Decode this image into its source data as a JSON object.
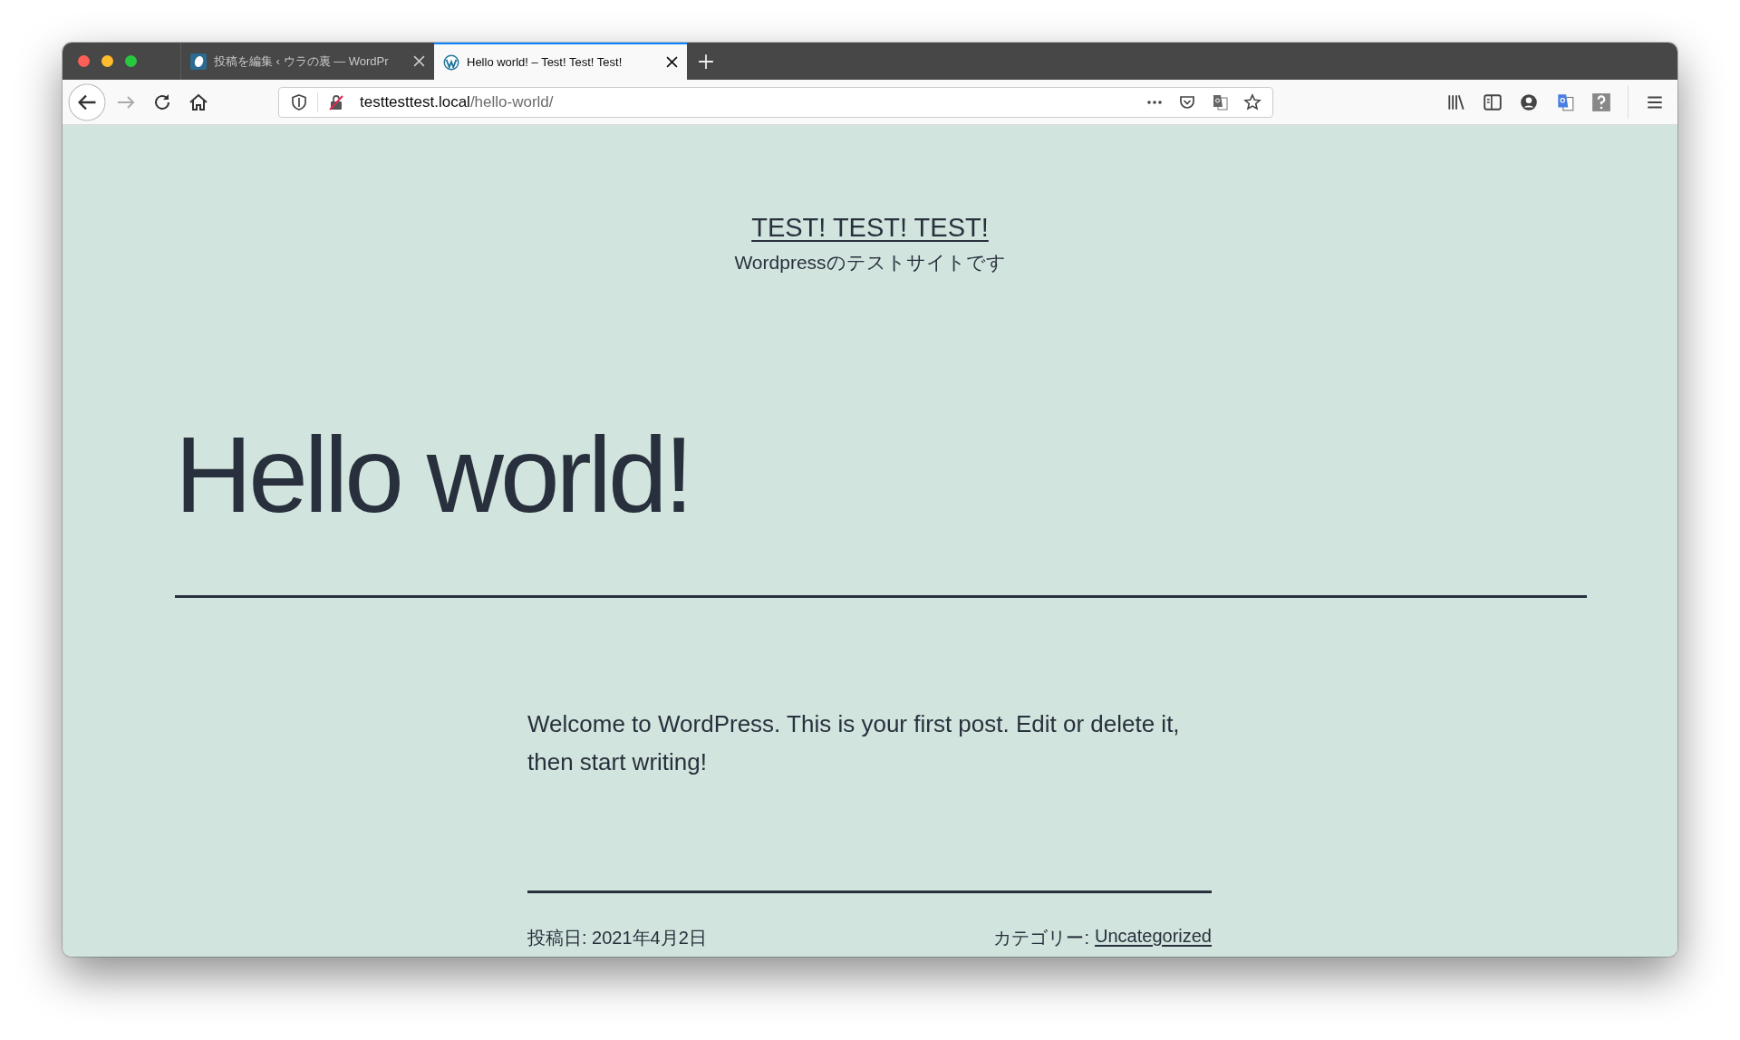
{
  "tabs": [
    {
      "kind": "site",
      "title": "投稿を編集 ‹ ウラの裏 — WordPr",
      "selected": false
    },
    {
      "kind": "wordpress",
      "title": "Hello world! – Test! Test! Test!",
      "selected": true
    }
  ],
  "nav": [
    {
      "kind": "back",
      "disabled": false
    },
    {
      "kind": "forward",
      "disabled": true
    },
    {
      "kind": "reload",
      "disabled": false
    },
    {
      "kind": "home",
      "disabled": false
    }
  ],
  "address": {
    "host": "testtesttest.local",
    "path": "/hello-world/"
  },
  "site": {
    "title": "TEST! TEST! TEST!",
    "tagline": "Wordpressのテストサイトです"
  },
  "post": {
    "title": "Hello world!",
    "body": "Welcome to WordPress. This is your first post. Edit or delete it, then start writing!",
    "posted": "投稿日: 2021年4月2日",
    "category_label": "カテゴリー:",
    "category": "Uncategorized"
  }
}
